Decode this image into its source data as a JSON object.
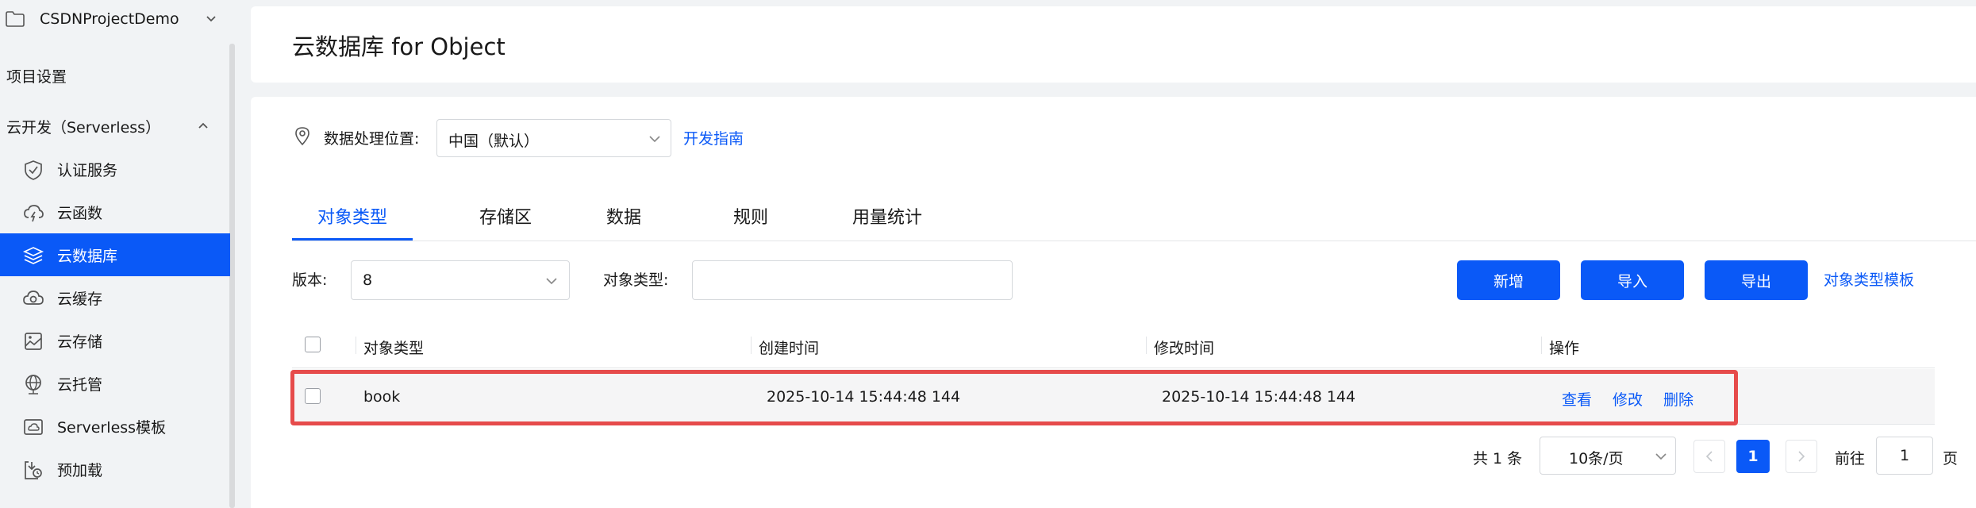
{
  "sidebar": {
    "project_name": "CSDNProjectDemo",
    "project_settings": "项目设置",
    "group_label": "云开发（Serverless）",
    "items": [
      {
        "label": "认证服务",
        "icon": "shield-check-icon"
      },
      {
        "label": "云函数",
        "icon": "cloud-function-icon"
      },
      {
        "label": "云数据库",
        "icon": "database-stack-icon",
        "active": true
      },
      {
        "label": "云缓存",
        "icon": "cloud-cache-icon"
      },
      {
        "label": "云存储",
        "icon": "cloud-storage-icon"
      },
      {
        "label": "云托管",
        "icon": "globe-icon"
      },
      {
        "label": "Serverless模板",
        "icon": "template-icon"
      },
      {
        "label": "预加载",
        "icon": "preload-icon"
      }
    ]
  },
  "header": {
    "title": "云数据库 for Object"
  },
  "location": {
    "label": "数据处理位置:",
    "selected": "中国（默认）",
    "guide_link": "开发指南"
  },
  "tabs": [
    {
      "label": "对象类型",
      "active": true
    },
    {
      "label": "存储区"
    },
    {
      "label": "数据"
    },
    {
      "label": "规则"
    },
    {
      "label": "用量统计"
    }
  ],
  "filters": {
    "version_label": "版本:",
    "version_value": "8",
    "object_type_label": "对象类型:",
    "object_type_value": ""
  },
  "actions": {
    "add": "新增",
    "import": "导入",
    "export": "导出",
    "template_link": "对象类型模板"
  },
  "table": {
    "columns": [
      "对象类型",
      "创建时间",
      "修改时间",
      "操作"
    ],
    "rows": [
      {
        "object_type": "book",
        "created": "2025-10-14 15:44:48 144",
        "modified": "2025-10-14 15:44:48 144",
        "ops": [
          "查看",
          "修改",
          "删除"
        ]
      }
    ]
  },
  "pagination": {
    "total": "共 1 条",
    "page_size": "10条/页",
    "current_page": "1",
    "goto_prefix": "前往",
    "goto_value": "1",
    "goto_suffix": "页"
  },
  "colors": {
    "primary": "#0a59f7",
    "highlight_border": "#e64b4b",
    "sidebar_bg": "#f1f3f5"
  }
}
